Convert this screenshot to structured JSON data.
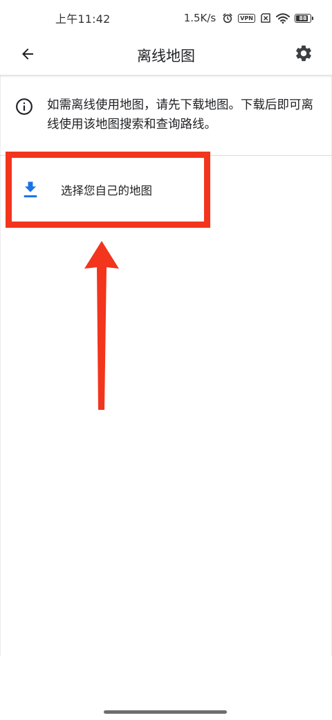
{
  "status_bar": {
    "time": "上午11:42",
    "network_speed": "1.5K/s",
    "vpn_label": "VPN",
    "battery_level": "88",
    "icons": [
      "alarm-icon",
      "vpn-icon",
      "sim-disabled-icon",
      "wifi-icon",
      "battery-icon"
    ]
  },
  "app_bar": {
    "title": "离线地图",
    "back_icon": "arrow-back-icon",
    "settings_icon": "gear-icon"
  },
  "info_banner": {
    "icon": "info-icon",
    "text": "如需离线使用地图，请先下载地图。下载后即可离线使用该地图搜索和查询路线。"
  },
  "select_own_map": {
    "icon": "download-icon",
    "label": "选择您自己的地图"
  },
  "colors": {
    "accent_blue": "#1a73e8",
    "annotation_red": "#f2351c",
    "text_primary": "#202124",
    "divider": "#dadce0"
  }
}
